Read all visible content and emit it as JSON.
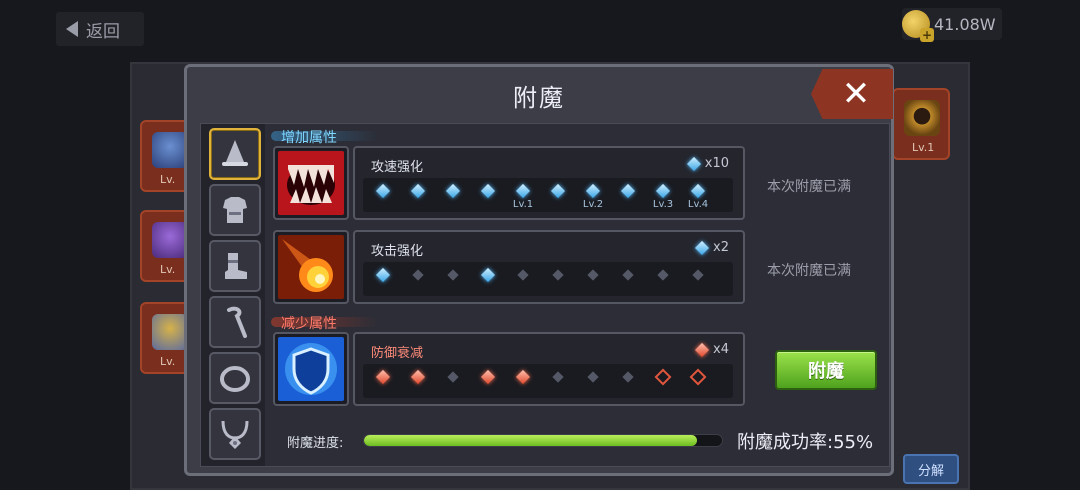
{
  "nav": {
    "back_label": "返回",
    "gold": "41.08W"
  },
  "background": {
    "slots": [
      {
        "level": "Lv."
      },
      {
        "level": "Lv."
      },
      {
        "level": "Lv."
      },
      {
        "level": "Lv.1"
      }
    ],
    "split_label": "分解"
  },
  "dialog": {
    "title": "附魔",
    "side_tabs": [
      {
        "icon": "hat-icon",
        "active": true
      },
      {
        "icon": "armor-icon",
        "active": false
      },
      {
        "icon": "boots-icon",
        "active": false
      },
      {
        "icon": "staff-icon",
        "active": false
      },
      {
        "icon": "ring-icon",
        "active": false
      },
      {
        "icon": "necklace-icon",
        "active": false
      }
    ],
    "add_section_label": "增加属性",
    "reduce_section_label": "减少属性",
    "stats": [
      {
        "name": "攻速强化",
        "count": "x10",
        "icon": "fangs-icon",
        "gems": [
          "blue",
          "blue",
          "blue",
          "blue",
          "blue",
          "blue",
          "blue",
          "blue",
          "blue",
          "blue"
        ],
        "level_marks": [
          {
            "index": 4,
            "label": "Lv.1"
          },
          {
            "index": 6,
            "label": "Lv.2"
          },
          {
            "index": 8,
            "label": "Lv.3"
          },
          {
            "index": 9,
            "label": "Lv.4"
          }
        ],
        "status": "本次附魔已满"
      },
      {
        "name": "攻击强化",
        "count": "x2",
        "icon": "fireball-icon",
        "gems": [
          "blue",
          "grey",
          "grey",
          "blue",
          "grey",
          "grey",
          "grey",
          "grey",
          "grey",
          "grey"
        ],
        "level_marks": [],
        "status": "本次附魔已满"
      },
      {
        "name": "防御衰减",
        "count": "x4",
        "icon": "shield-icon",
        "gems": [
          "red",
          "red",
          "grey",
          "red",
          "red",
          "grey",
          "grey",
          "grey",
          "hollow",
          "hollow"
        ],
        "level_marks": [],
        "status": ""
      }
    ],
    "enchant_button": "附魔",
    "progress_label": "附魔进度:",
    "progress_fraction": 0.93,
    "success_rate": "附魔成功率:55%",
    "colors": {
      "accent_green": "#6cbd22",
      "tab_active": "#e0b43a",
      "close_red": "#8d3522"
    }
  }
}
